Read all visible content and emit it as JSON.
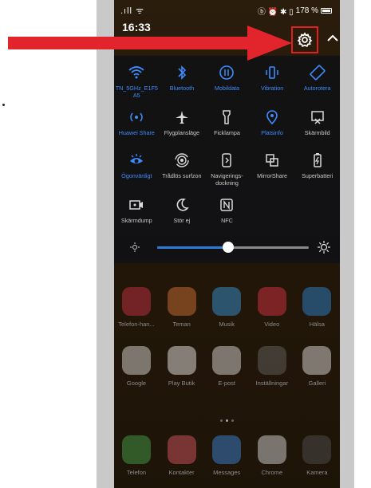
{
  "status": {
    "signal": ".ıll ᯤ",
    "right_icons": "ⓑ ⏰ ✱ ▯",
    "battery_pct": "178 %"
  },
  "header": {
    "time": "16:33",
    "date": ""
  },
  "quick_settings": {
    "row1": [
      {
        "label": "TN_5GHz_E1F5 A5",
        "icon": "wifi-icon",
        "on": true
      },
      {
        "label": "Bluetooth",
        "icon": "bluetooth-icon",
        "on": true
      },
      {
        "label": "Mobildata",
        "icon": "mobile-data-icon",
        "on": true
      },
      {
        "label": "Vibration",
        "icon": "vibration-icon",
        "on": true
      },
      {
        "label": "Autorotera",
        "icon": "autorotate-icon",
        "on": true
      }
    ],
    "row2": [
      {
        "label": "Huawei Share",
        "icon": "huawei-share-icon",
        "on": true
      },
      {
        "label": "Flygplansläge",
        "icon": "airplane-icon",
        "on": false
      },
      {
        "label": "Ficklampa",
        "icon": "flashlight-icon",
        "on": false
      },
      {
        "label": "Platsinfo",
        "icon": "location-icon",
        "on": true
      },
      {
        "label": "Skärmbild",
        "icon": "screenshot-icon",
        "on": false
      }
    ],
    "row3": [
      {
        "label": "Ögonvänligt",
        "icon": "eye-comfort-icon",
        "on": true
      },
      {
        "label": "Trådlös surfzon",
        "icon": "hotspot-icon",
        "on": false
      },
      {
        "label": "Navigerings-dockning",
        "icon": "navigation-dock-icon",
        "on": false
      },
      {
        "label": "MirrorShare",
        "icon": "mirrorshare-icon",
        "on": false
      },
      {
        "label": "Superbatteri",
        "icon": "super-battery-icon",
        "on": false
      }
    ],
    "row4": [
      {
        "label": "Skärmdump",
        "icon": "screen-record-icon",
        "on": false
      },
      {
        "label": "Stör ej",
        "icon": "do-not-disturb-icon",
        "on": false
      },
      {
        "label": "NFC",
        "icon": "nfc-icon",
        "on": false
      }
    ]
  },
  "brightness": {
    "level": 0.47
  },
  "home": {
    "row1": [
      {
        "label": "Telefon-han...",
        "color": "#d8314a"
      },
      {
        "label": "Teman",
        "color": "#e07a3b"
      },
      {
        "label": "Musik",
        "color": "#3aa0e6"
      },
      {
        "label": "Video",
        "color": "#e8344a"
      },
      {
        "label": "Hälsa",
        "color": "#2e8fe0"
      }
    ],
    "row2": [
      {
        "label": "Google",
        "color": "#eeeeee"
      },
      {
        "label": "Play Butik",
        "color": "#ffffff"
      },
      {
        "label": "E-post",
        "color": "#ededed"
      },
      {
        "label": "Inställningar",
        "color": "#6b6b6b"
      },
      {
        "label": "Galleri",
        "color": "#f1f1f1"
      }
    ],
    "dock": [
      {
        "label": "Telefon",
        "color": "#4caf50"
      },
      {
        "label": "Kontakter",
        "color": "#e85a6a"
      },
      {
        "label": "Messages",
        "color": "#3f8fe8"
      },
      {
        "label": "Chrome",
        "color": "#e8e8e8"
      },
      {
        "label": "Kamera",
        "color": "#555555"
      }
    ]
  },
  "colors": {
    "accent": "#3d8cff",
    "highlight_box": "#e0211d",
    "arrow": "#e2242d"
  }
}
